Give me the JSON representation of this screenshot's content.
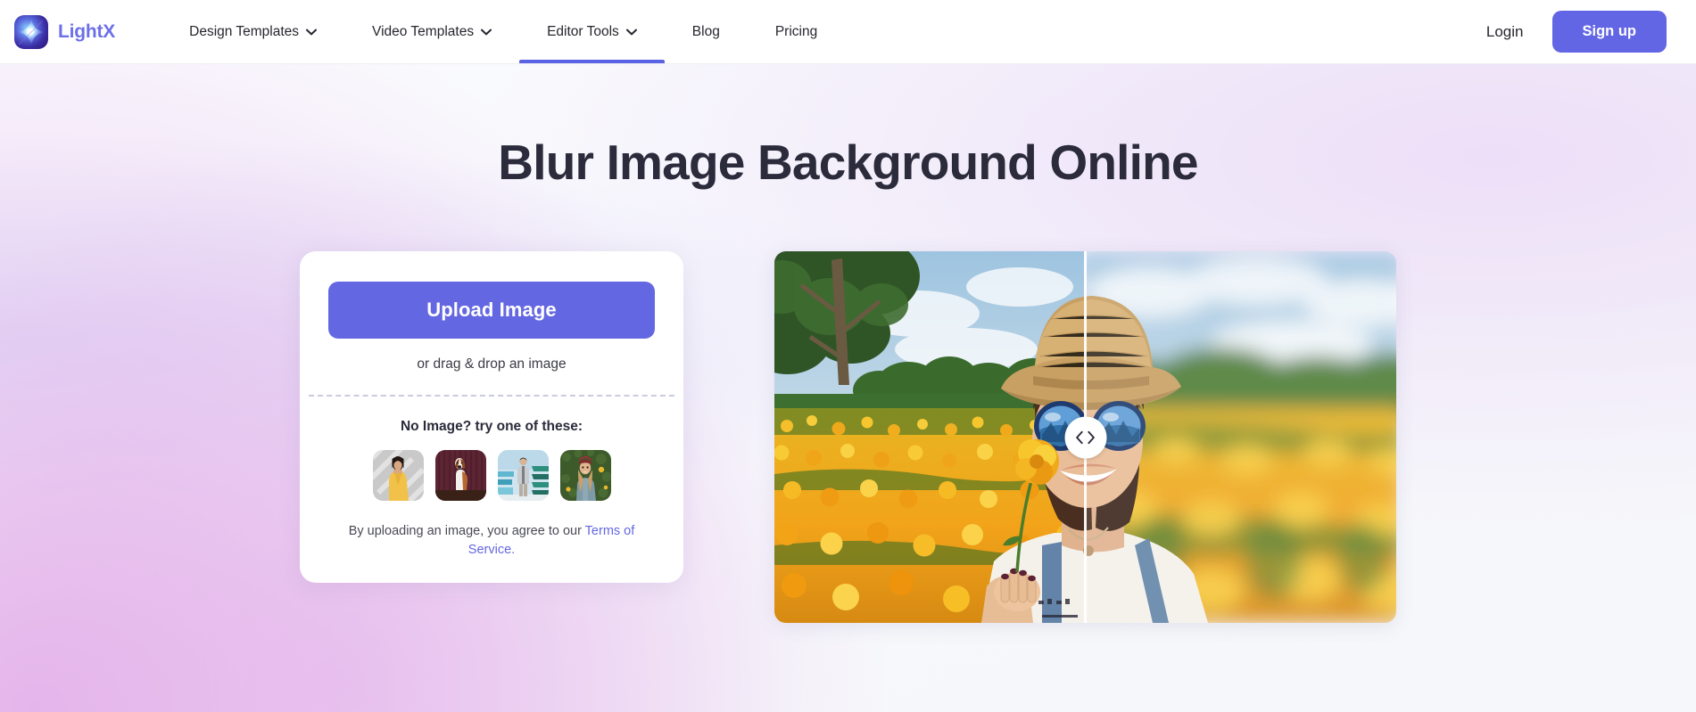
{
  "brand": {
    "name": "LightX",
    "logo_icon": "lightx-star-logo-icon"
  },
  "nav": {
    "items": [
      {
        "label": "Design Templates",
        "has_caret": true,
        "active": false
      },
      {
        "label": "Video Templates",
        "has_caret": true,
        "active": false
      },
      {
        "label": "Editor Tools",
        "has_caret": true,
        "active": true
      },
      {
        "label": "Blog",
        "has_caret": false,
        "active": false
      },
      {
        "label": "Pricing",
        "has_caret": false,
        "active": false
      }
    ]
  },
  "header_right": {
    "login_label": "Login",
    "signup_label": "Sign up"
  },
  "hero": {
    "title": "Blur Image Background Online"
  },
  "upload": {
    "button_label": "Upload Image",
    "drag_text": "or drag & drop an image",
    "samples_label": "No Image? try one of these:",
    "samples": [
      {
        "name": "woman-in-yellow-outfit-sample"
      },
      {
        "name": "beagle-dog-sample"
      },
      {
        "name": "man-standing-sample"
      },
      {
        "name": "woman-with-beanie-sample"
      }
    ],
    "terms_prefix": "By uploading an image, you agree to our ",
    "terms_link": "Terms of Service.",
    "upload_note": ""
  },
  "preview": {
    "alt": "Before and after background blur comparison of a woman in a marigold field",
    "prev_icon": "chevron-left-icon",
    "next_icon": "chevron-right-icon"
  },
  "colors": {
    "accent": "#6366e4",
    "brand_text": "#6d6fe8",
    "heading": "#2b2b3c",
    "header_bg": "#ffffff",
    "card_bg": "#ffffff",
    "page_bg": "#f7f8fb",
    "link": "#6467e2"
  }
}
